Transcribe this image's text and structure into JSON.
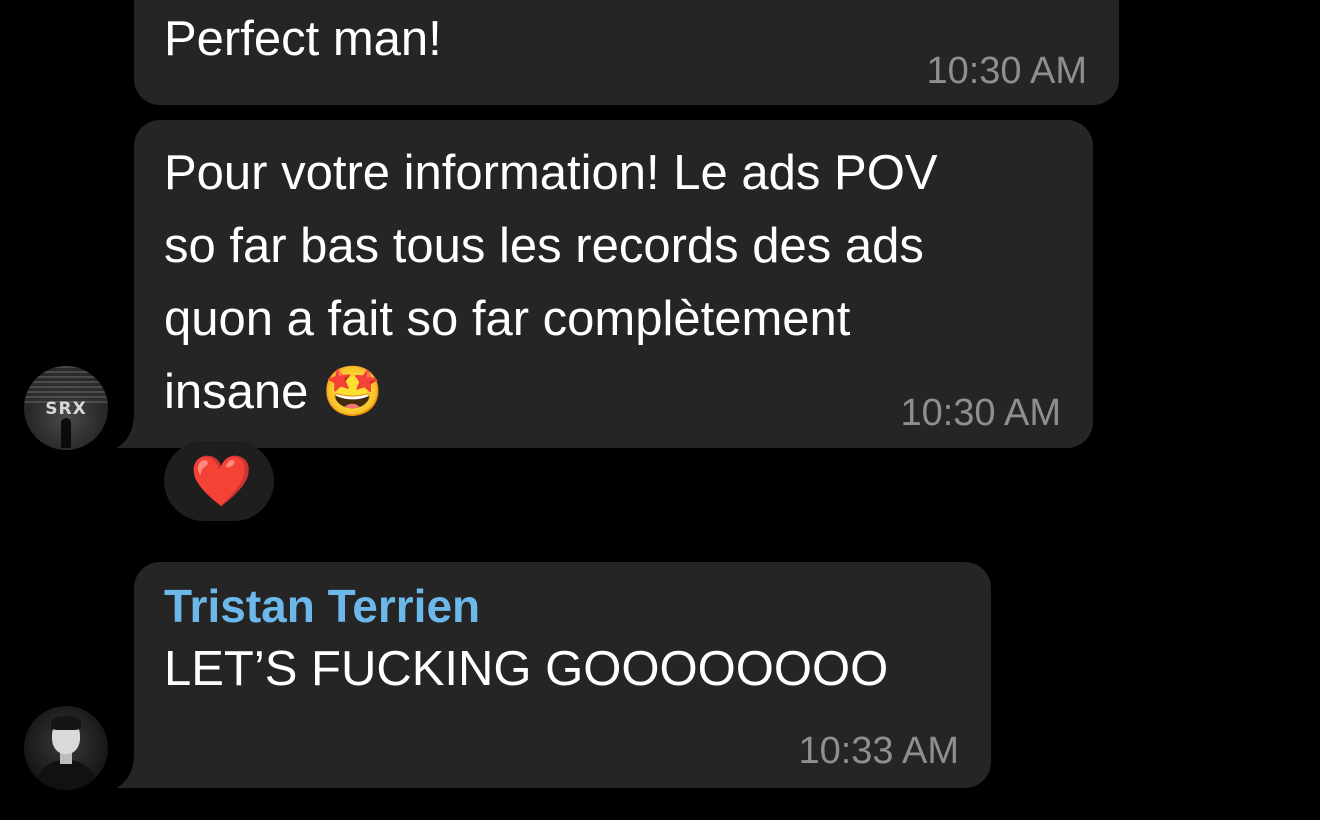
{
  "messages": [
    {
      "text": "Perfect man!",
      "time": "10:30 AM"
    },
    {
      "text": "Pour votre information! Le ads POV\nso far bas tous les records des ads\nquon a fait so far complètement\ninsane 🤩",
      "time": "10:30 AM",
      "avatar": "SRX",
      "reaction": "❤️"
    },
    {
      "sender": "Tristan Terrien",
      "text": "LET’S FUCKING GOOOOOOOO",
      "time": "10:33 AM"
    }
  ],
  "colors": {
    "background": "#000000",
    "bubble": "#252526",
    "timestamp": "#8e8e93",
    "sender_name": "#6cb8ea",
    "reaction_bg": "#1e1e1f"
  },
  "icons": {
    "reaction": "red-heart-icon",
    "avatar1": "srx-logo-avatar",
    "avatar2": "user-photo-avatar"
  }
}
